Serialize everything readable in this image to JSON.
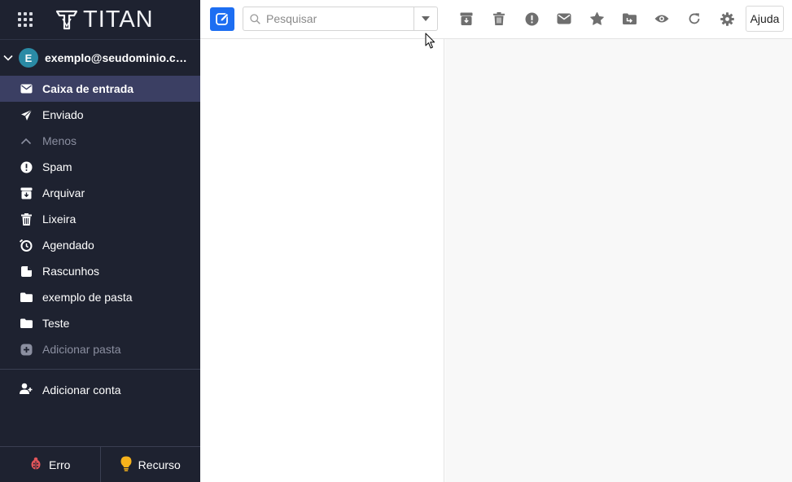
{
  "brand": {
    "name": "TITAN"
  },
  "account": {
    "avatar_letter": "E",
    "email": "exemplo@seudominio.co..."
  },
  "folders": [
    {
      "label": "Caixa de entrada",
      "icon": "envelope-icon",
      "active": true
    },
    {
      "label": "Enviado",
      "icon": "paper-plane-icon"
    },
    {
      "label": "Menos",
      "icon": "chevron-up-icon",
      "muted": true
    },
    {
      "label": "Spam",
      "icon": "exclamation-circle-icon"
    },
    {
      "label": "Arquivar",
      "icon": "archive-icon"
    },
    {
      "label": "Lixeira",
      "icon": "trash-icon"
    },
    {
      "label": "Agendado",
      "icon": "scheduled-clock-icon"
    },
    {
      "label": "Rascunhos",
      "icon": "draft-icon"
    },
    {
      "label": "exemplo de pasta",
      "icon": "folder-icon"
    },
    {
      "label": "Teste",
      "icon": "folder-icon"
    },
    {
      "label": "Adicionar pasta",
      "icon": "add-folder-icon",
      "muted": true
    }
  ],
  "add_account": {
    "label": "Adicionar conta"
  },
  "bottom": {
    "bug_label": "Erro",
    "feature_label": "Recurso"
  },
  "toolbar": {
    "search_placeholder": "Pesquisar",
    "help_label": "Ajuda",
    "icons": [
      "archive-icon",
      "trash-icon",
      "spam-icon",
      "envelope-icon",
      "star-icon",
      "move-folder-icon",
      "eye-icon",
      "refresh-icon",
      "gear-icon"
    ]
  },
  "colors": {
    "sidebar_bg": "#1e2230",
    "active_folder_bg": "#3b3f63",
    "accent": "#1d6ef2",
    "reading_pane_bg": "#f8f8f8"
  }
}
